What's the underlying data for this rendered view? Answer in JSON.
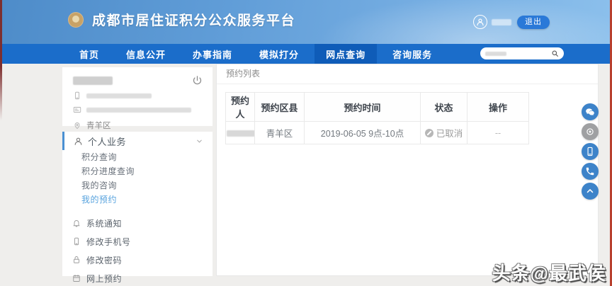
{
  "header": {
    "title": "成都市居住证积分公众服务平台",
    "logout_button": "退出"
  },
  "nav": {
    "items": [
      {
        "label": "首页"
      },
      {
        "label": "信息公开"
      },
      {
        "label": "办事指南"
      },
      {
        "label": "模拟打分"
      },
      {
        "label": "网点查询"
      },
      {
        "label": "咨询服务"
      }
    ],
    "active_item": "网点查询"
  },
  "sidebar": {
    "user": {
      "district": "青羊区"
    },
    "section": {
      "label": "个人业务"
    },
    "menu": [
      {
        "label": "积分查询"
      },
      {
        "label": "积分进度查询"
      },
      {
        "label": "我的咨询"
      },
      {
        "label": "我的预约"
      }
    ],
    "active_menu_item": "我的预约",
    "tools": [
      {
        "label": "系统通知"
      },
      {
        "label": "修改手机号"
      },
      {
        "label": "修改密码"
      },
      {
        "label": "网上预约"
      }
    ]
  },
  "main": {
    "panel_title": "预约列表",
    "table": {
      "headers": [
        "预约人",
        "预约区县",
        "预约时间",
        "状态",
        "操作"
      ],
      "row": {
        "district": "青羊区",
        "time": "2019-06-05 9点-10点",
        "status": "已取消",
        "operation": "--"
      }
    }
  },
  "floating_icons": [
    "wechat-icon",
    "weibo-icon",
    "mobile-app-icon",
    "phone-icon",
    "back-to-top-icon"
  ],
  "watermark": "头条@最武侯",
  "colors": {
    "header_gradient": "#5f9cd7",
    "nav_blue": "#1b6dca",
    "nav_active_blue": "#0f5cb8",
    "brand_gold": "#c8a266",
    "logout_blue": "#2a79d8",
    "active_menu_text": "#58a3de",
    "status_gray": "#9b9b9b",
    "float_blue": "#3d83c9",
    "float_gray": "#9fa0a2",
    "edge_red": "#b8402e"
  }
}
